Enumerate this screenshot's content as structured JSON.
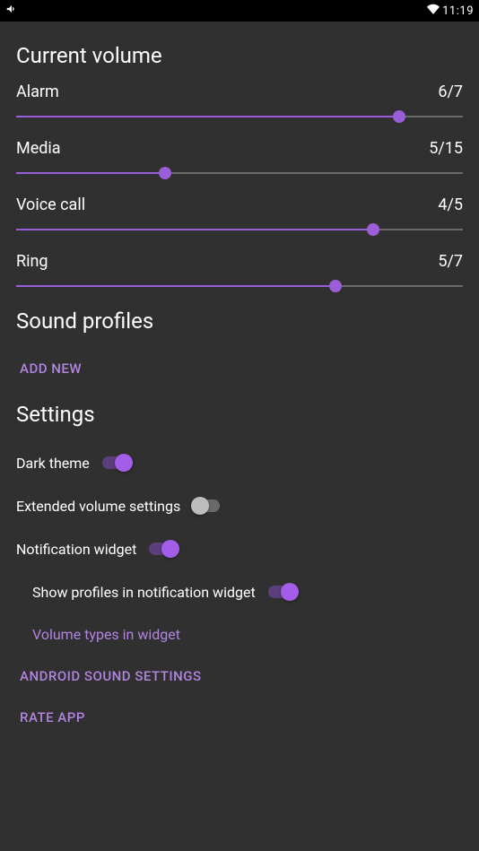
{
  "status": {
    "time": "11:19"
  },
  "colors": {
    "accent": "#a45de8",
    "link": "#b184e0"
  },
  "sections": {
    "current_volume": "Current volume",
    "sound_profiles": "Sound profiles",
    "settings": "Settings"
  },
  "volumes": [
    {
      "label": "Alarm",
      "value": 6,
      "max": 7,
      "display": "6/7"
    },
    {
      "label": "Media",
      "value": 5,
      "max": 15,
      "display": "5/15"
    },
    {
      "label": "Voice call",
      "value": 4,
      "max": 5,
      "display": "4/5"
    },
    {
      "label": "Ring",
      "value": 5,
      "max": 7,
      "display": "5/7"
    }
  ],
  "profiles": {
    "add_new": "ADD NEW"
  },
  "settings": {
    "dark_theme": {
      "label": "Dark theme",
      "on": true
    },
    "extended": {
      "label": "Extended volume settings",
      "on": false
    },
    "notif_widget": {
      "label": "Notification widget",
      "on": true
    },
    "show_profiles": {
      "label": "Show profiles in notification widget",
      "on": true
    },
    "vol_types_link": "Volume types in widget",
    "android_sound": "ANDROID SOUND SETTINGS",
    "rate_app": "RATE APP"
  }
}
